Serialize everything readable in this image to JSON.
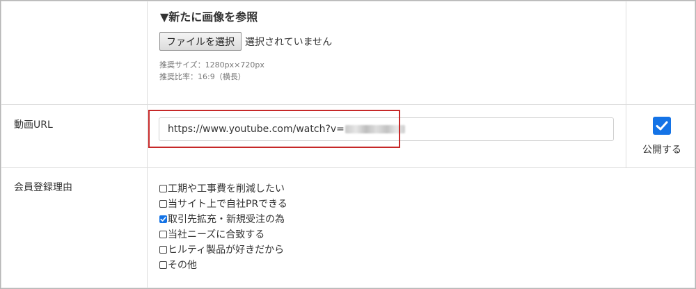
{
  "image_section": {
    "heading": "▼新たに画像を参照",
    "file_button_label": "ファイルを選択",
    "file_status": "選択されていません",
    "size_hint": "推奨サイズ：1280px×720px",
    "ratio_hint": "推奨比率：16:9（横長）"
  },
  "video_section": {
    "label": "動画URL",
    "url_value": "https://www.youtube.com/watch?v=",
    "publish_checked": true,
    "publish_label": "公開する"
  },
  "reason_section": {
    "label": "会員登録理由",
    "options": [
      {
        "label": "工期や工事費を削減したい",
        "checked": false
      },
      {
        "label": "当サイト上で自社PRできる",
        "checked": false
      },
      {
        "label": "取引先拡充・新規受注の為",
        "checked": true
      },
      {
        "label": "当社ニーズに合致する",
        "checked": false
      },
      {
        "label": "ヒルティ製品が好きだから",
        "checked": false
      },
      {
        "label": "その他",
        "checked": false
      }
    ]
  },
  "colors": {
    "accent": "#1473e6",
    "highlight": "#c62828",
    "border": "#dddddd"
  }
}
